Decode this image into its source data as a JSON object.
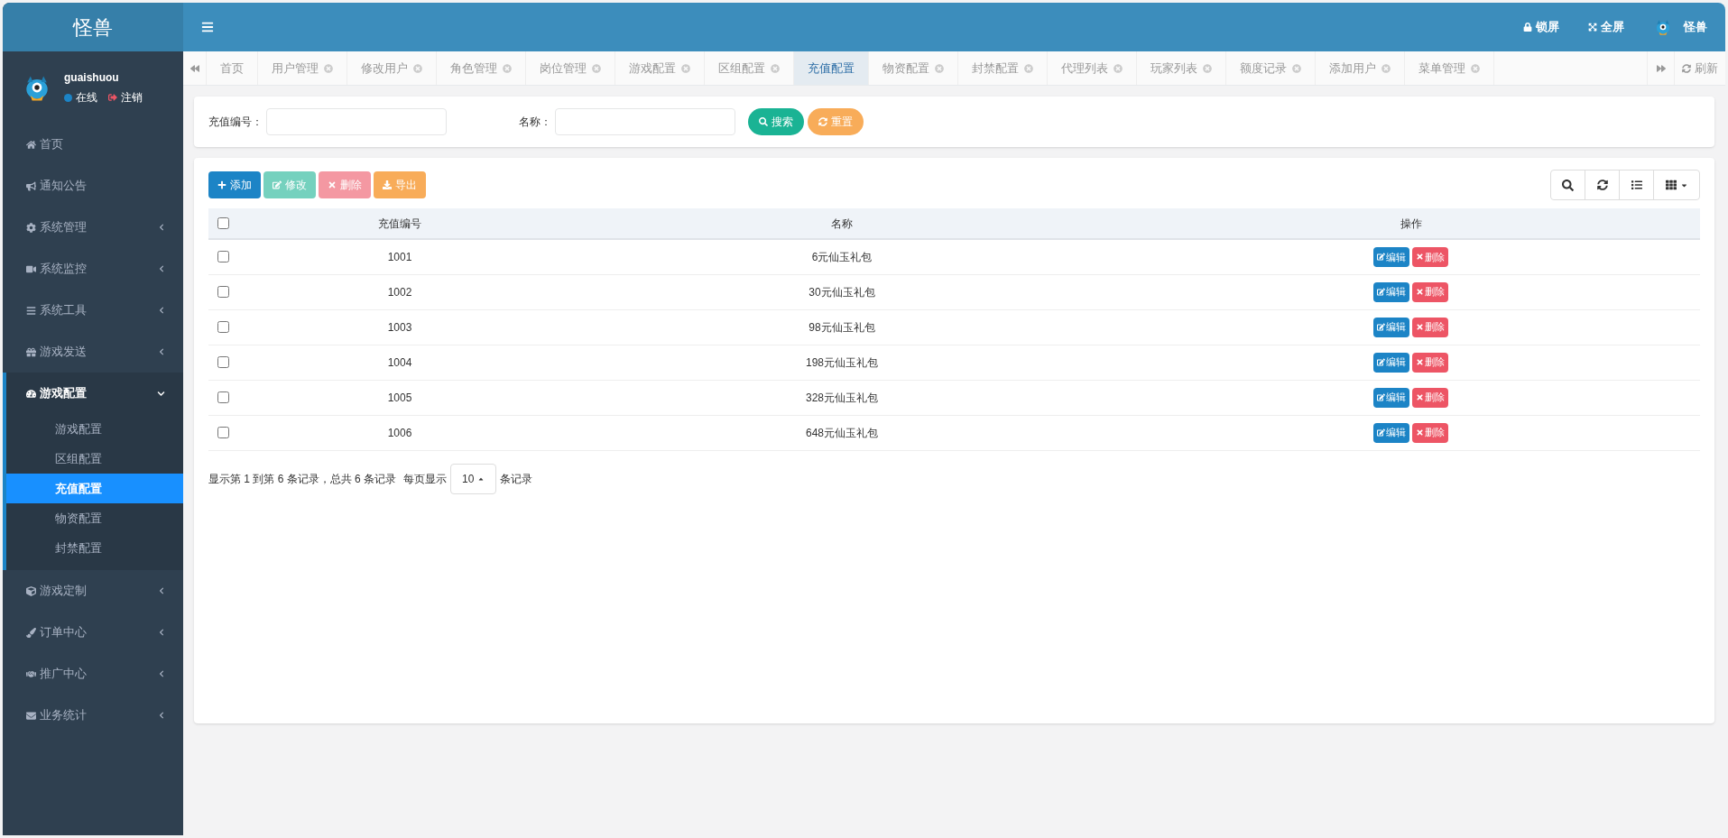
{
  "brand": "怪兽",
  "user": {
    "name": "guaishuou",
    "status": "在线",
    "logout": "注销"
  },
  "header": {
    "lock": "锁屏",
    "fullscreen": "全屏",
    "username": "怪兽"
  },
  "sidebar": {
    "items": [
      {
        "label": "首页",
        "has_children": false,
        "expanded": false
      },
      {
        "label": "通知公告",
        "has_children": false,
        "expanded": false
      },
      {
        "label": "系统管理",
        "has_children": true,
        "expanded": false
      },
      {
        "label": "系统监控",
        "has_children": true,
        "expanded": false
      },
      {
        "label": "系统工具",
        "has_children": true,
        "expanded": false
      },
      {
        "label": "游戏发送",
        "has_children": true,
        "expanded": false
      },
      {
        "label": "游戏配置",
        "has_children": true,
        "expanded": true,
        "children": [
          {
            "label": "游戏配置",
            "selected": false
          },
          {
            "label": "区组配置",
            "selected": false
          },
          {
            "label": "充值配置",
            "selected": true
          },
          {
            "label": "物资配置",
            "selected": false
          },
          {
            "label": "封禁配置",
            "selected": false
          }
        ]
      },
      {
        "label": "游戏定制",
        "has_children": true,
        "expanded": false
      },
      {
        "label": "订单中心",
        "has_children": true,
        "expanded": false
      },
      {
        "label": "推广中心",
        "has_children": true,
        "expanded": false
      },
      {
        "label": "业务统计",
        "has_children": true,
        "expanded": false
      }
    ]
  },
  "tabs": [
    {
      "label": "首页",
      "closable": false,
      "selected": false
    },
    {
      "label": "用户管理",
      "closable": true,
      "selected": false
    },
    {
      "label": "修改用户",
      "closable": true,
      "selected": false
    },
    {
      "label": "角色管理",
      "closable": true,
      "selected": false
    },
    {
      "label": "岗位管理",
      "closable": true,
      "selected": false
    },
    {
      "label": "游戏配置",
      "closable": true,
      "selected": false
    },
    {
      "label": "区组配置",
      "closable": true,
      "selected": false
    },
    {
      "label": "充值配置",
      "closable": false,
      "selected": true
    },
    {
      "label": "物资配置",
      "closable": true,
      "selected": false
    },
    {
      "label": "封禁配置",
      "closable": true,
      "selected": false
    },
    {
      "label": "代理列表",
      "closable": true,
      "selected": false
    },
    {
      "label": "玩家列表",
      "closable": true,
      "selected": false
    },
    {
      "label": "额度记录",
      "closable": true,
      "selected": false
    },
    {
      "label": "添加用户",
      "closable": true,
      "selected": false
    },
    {
      "label": "菜单管理",
      "closable": true,
      "selected": false
    }
  ],
  "refresh": "刷新",
  "search": {
    "fields": [
      {
        "label": "充值编号："
      },
      {
        "label": "名称："
      }
    ],
    "search_button": "搜索",
    "reset_button": "重置"
  },
  "toolbar": [
    {
      "label": "添加",
      "kind": "add"
    },
    {
      "label": "修改",
      "kind": "edit"
    },
    {
      "label": "删除",
      "kind": "delete"
    },
    {
      "label": "导出",
      "kind": "export"
    }
  ],
  "table": {
    "select_all_checked": false,
    "columns": [
      "充值编号",
      "名称",
      "操作"
    ],
    "rows": [
      {
        "id": "1001",
        "name": "6元仙玉礼包",
        "checked": false,
        "actions": [
          "编辑",
          "删除"
        ]
      },
      {
        "id": "1002",
        "name": "30元仙玉礼包",
        "checked": false,
        "actions": [
          "编辑",
          "删除"
        ]
      },
      {
        "id": "1003",
        "name": "98元仙玉礼包",
        "checked": false,
        "actions": [
          "编辑",
          "删除"
        ]
      },
      {
        "id": "1004",
        "name": "198元仙玉礼包",
        "checked": false,
        "actions": [
          "编辑",
          "删除"
        ]
      },
      {
        "id": "1005",
        "name": "328元仙玉礼包",
        "checked": false,
        "actions": [
          "编辑",
          "删除"
        ]
      },
      {
        "id": "1006",
        "name": "648元仙玉礼包",
        "checked": false,
        "actions": [
          "编辑",
          "删除"
        ]
      }
    ]
  },
  "pagination": {
    "summary": "显示第 1 到第 6 条记录，总共 6 条记录",
    "per_page_label": "每页显示",
    "per_page": "10",
    "suffix": "条记录"
  }
}
